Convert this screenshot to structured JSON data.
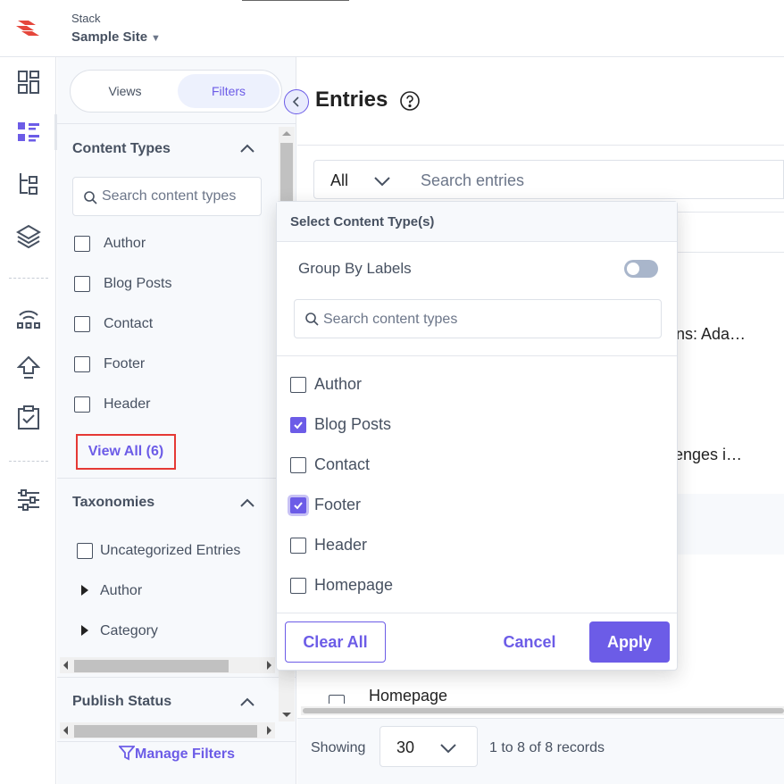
{
  "header": {
    "stack_label": "Stack",
    "site_name": "Sample Site"
  },
  "rail": {
    "icons": [
      "dashboard-icon",
      "entries-icon",
      "content-models-icon",
      "assets-icon",
      "releases-icon",
      "deploy-icon",
      "tasks-icon",
      "settings-icon"
    ]
  },
  "filter_panel": {
    "tabs": {
      "views": "Views",
      "filters": "Filters"
    },
    "content_types": {
      "title": "Content Types",
      "search_placeholder": "Search content types",
      "items": [
        "Author",
        "Blog Posts",
        "Contact",
        "Footer",
        "Header"
      ],
      "view_all": "View All (6)"
    },
    "taxonomies": {
      "title": "Taxonomies",
      "items": [
        "Uncategorized Entries",
        "Author",
        "Category"
      ]
    },
    "publish_status": {
      "title": "Publish Status"
    },
    "manage_filters": "Manage Filters"
  },
  "main": {
    "title": "Entries",
    "scope_select": "All",
    "search_placeholder": "Search entries",
    "rows_partial": [
      "ons: Ada…",
      "llenges i…",
      "Homepage"
    ],
    "footer": {
      "showing": "Showing",
      "page_size": "30",
      "records": "1 to 8 of 8 records"
    }
  },
  "dropdown": {
    "title": "Select Content Type(s)",
    "group_by_labels": "Group By Labels",
    "group_by_enabled": false,
    "search_placeholder": "Search content types",
    "options": [
      {
        "label": "Author",
        "checked": false
      },
      {
        "label": "Blog Posts",
        "checked": true
      },
      {
        "label": "Contact",
        "checked": false
      },
      {
        "label": "Footer",
        "checked": true
      },
      {
        "label": "Header",
        "checked": false
      },
      {
        "label": "Homepage",
        "checked": false
      }
    ],
    "clear_all": "Clear All",
    "cancel": "Cancel",
    "apply": "Apply"
  },
  "colors": {
    "accent": "#6c5ce7",
    "text": "#475161",
    "highlight_border": "#e53935",
    "panel_bg": "#f7f9fc"
  }
}
